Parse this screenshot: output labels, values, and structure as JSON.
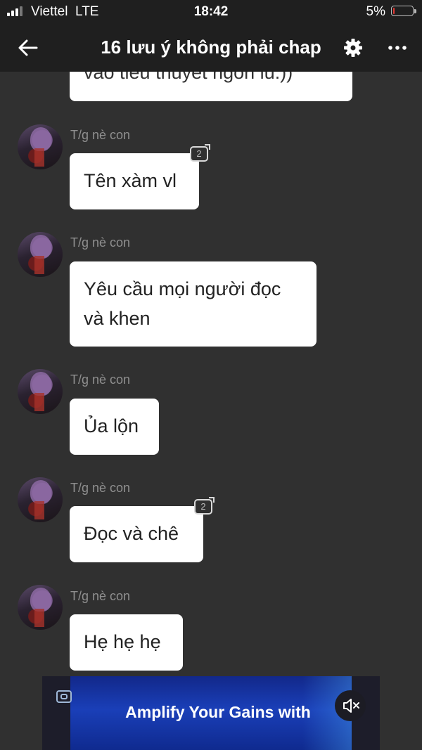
{
  "status_bar": {
    "carrier": "Viettel",
    "network": "LTE",
    "time": "18:42",
    "battery_percent": "5%",
    "battery_level": 0.05
  },
  "nav": {
    "title": "16 lưu ý không phải chap"
  },
  "partial_message": {
    "text": "vào tiểu thuyết ngôn lù.))"
  },
  "messages": [
    {
      "sender": "T/g nè con",
      "text": "Tên xàm vl",
      "reply_count": "2"
    },
    {
      "sender": "T/g nè con",
      "text": "Yêu cầu mọi người đọc và khen"
    },
    {
      "sender": "T/g nè con",
      "text": "Ủa lộn"
    },
    {
      "sender": "T/g nè con",
      "text": "Đọc và chê",
      "reply_count": "2"
    },
    {
      "sender": "T/g nè con",
      "text": "Hẹ hẹ hẹ"
    }
  ],
  "ad": {
    "text": "Amplify Your Gains with"
  },
  "icons": [
    "back-arrow-icon",
    "gear-icon",
    "more-icon",
    "ad-choices-icon",
    "mute-icon"
  ]
}
